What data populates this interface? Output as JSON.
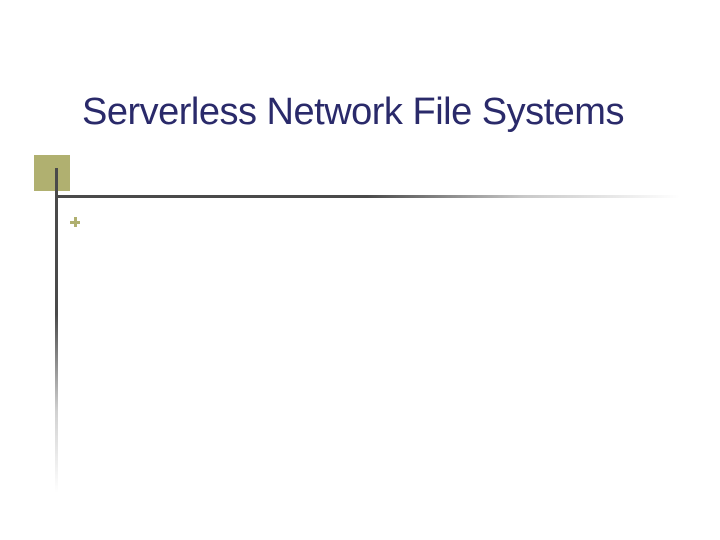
{
  "title": "Serverless Network File Systems",
  "colors": {
    "title_color": "#2a2a6a",
    "accent_square": "#b0b070",
    "line_color": "#4a4a4a",
    "bullet_color": "#b0b070"
  }
}
